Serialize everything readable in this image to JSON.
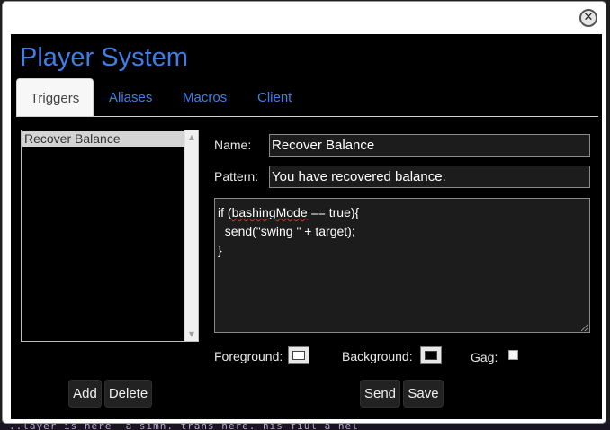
{
  "background_text": "..layer is here _a simh. trans here. his fiul a hel",
  "dialog": {
    "close_glyph": "✕",
    "title": "Player System",
    "tabs": [
      {
        "label": "Triggers",
        "active": true
      },
      {
        "label": "Aliases",
        "active": false
      },
      {
        "label": "Macros",
        "active": false
      },
      {
        "label": "Client",
        "active": false
      }
    ],
    "trigger_list": {
      "items": [
        "Recover Balance"
      ],
      "selected": "Recover Balance"
    },
    "form": {
      "name_label": "Name:",
      "name_value": "Recover Balance",
      "pattern_label": "Pattern:",
      "pattern_value": "You have recovered balance.",
      "code": {
        "line1_pre": "if (",
        "line1_word": "bashingMode",
        "line1_post": " == true){",
        "line2": "  send(\"swing \" + target);",
        "line3": "}"
      },
      "foreground_label": "Foreground:",
      "foreground_color": "#ffffff",
      "background_label": "Background:",
      "background_color": "#000000",
      "gag_label": "Gag:",
      "gag_checked": false
    },
    "buttons": {
      "add": "Add",
      "delete": "Delete",
      "send": "Send",
      "save": "Save"
    },
    "colors": {
      "accent": "#3f7ee4",
      "panel": "#000000",
      "input_bg": "#1c1c1c"
    }
  }
}
